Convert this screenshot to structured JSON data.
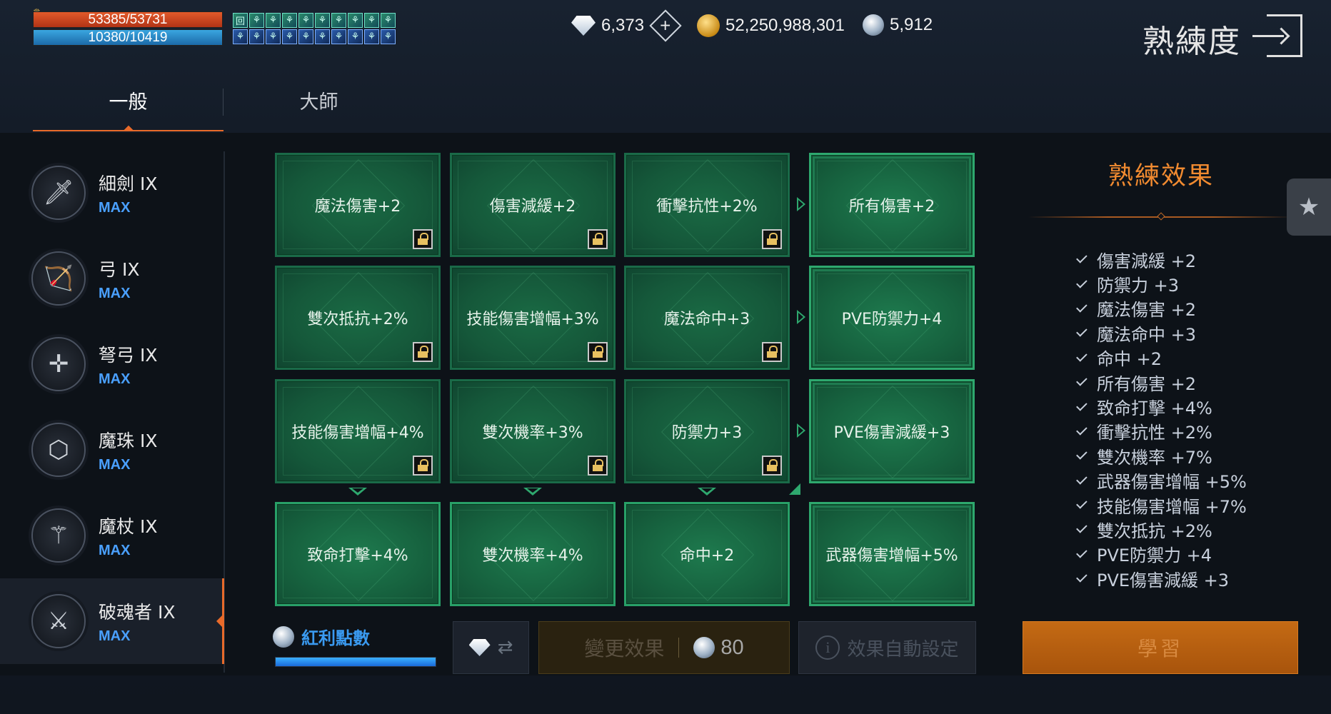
{
  "status": {
    "hp": "53385/53731",
    "mp": "10380/10419",
    "buff_row1": [
      "回",
      "⚘",
      "⚘",
      "⚘",
      "⚘",
      "⚘",
      "⚘",
      "⚘",
      "⚘",
      "⚘"
    ],
    "buff_row2": [
      "⚘",
      "⚘",
      "⚘",
      "⚘",
      "⚘",
      "⚘",
      "⚘",
      "⚘",
      "⚘",
      "⚘"
    ]
  },
  "currencies": {
    "diamond": "6,373",
    "gold": "52,250,988,301",
    "orb": "5,912"
  },
  "header": {
    "title": "熟練度"
  },
  "tabs": [
    {
      "label": "一般",
      "active": true
    },
    {
      "label": "大師",
      "active": false
    }
  ],
  "weapons": [
    {
      "name": "細劍 IX",
      "level": "MAX",
      "icon": "rapier-icon"
    },
    {
      "name": "弓 IX",
      "level": "MAX",
      "icon": "bow-icon"
    },
    {
      "name": "弩弓 IX",
      "level": "MAX",
      "icon": "crossbow-icon"
    },
    {
      "name": "魔珠 IX",
      "level": "MAX",
      "icon": "orb-icon"
    },
    {
      "name": "魔杖 IX",
      "level": "MAX",
      "icon": "wand-icon"
    },
    {
      "name": "破魂者 IX",
      "level": "MAX",
      "icon": "greatsword-icon",
      "active": true
    }
  ],
  "grid": {
    "rows": [
      {
        "cells": [
          {
            "label": "魔法傷害+2",
            "locked": true
          },
          {
            "label": "傷害減緩+2",
            "locked": true
          },
          {
            "label": "衝擊抗性+2%",
            "locked": true
          }
        ],
        "reward": "所有傷害+2"
      },
      {
        "cells": [
          {
            "label": "雙次抵抗+2%",
            "locked": true
          },
          {
            "label": "技能傷害增幅+3%",
            "locked": true
          },
          {
            "label": "魔法命中+3",
            "locked": true
          }
        ],
        "reward": "PVE防禦力+4"
      },
      {
        "cells": [
          {
            "label": "技能傷害增幅+4%",
            "locked": true
          },
          {
            "label": "雙次機率+3%",
            "locked": true
          },
          {
            "label": "防禦力+3",
            "locked": true
          }
        ],
        "reward": "PVE傷害減緩+3"
      },
      {
        "cells": [
          {
            "label": "致命打擊+4%",
            "locked": false
          },
          {
            "label": "雙次機率+4%",
            "locked": false
          },
          {
            "label": "命中+2",
            "locked": false
          }
        ],
        "reward": "武器傷害增幅+5%"
      }
    ]
  },
  "effects": {
    "title": "熟練效果",
    "items": [
      "傷害減緩 +2",
      "防禦力 +3",
      "魔法傷害 +2",
      "魔法命中 +3",
      "命中 +2",
      "所有傷害 +2",
      "致命打擊 +4%",
      "衝擊抗性 +2%",
      "雙次機率 +7%",
      "武器傷害增幅 +5%",
      "技能傷害增幅 +7%",
      "雙次抵抗 +2%",
      "PVE防禦力 +4",
      "PVE傷害減緩 +3"
    ]
  },
  "bottom": {
    "bonus_label": "紅利點數",
    "bonus_fill": 1.0,
    "change_label": "變更效果",
    "change_cost": "80",
    "auto_label": "效果自動設定",
    "learn_label": "學習"
  },
  "colors": {
    "accent": "#e86a2a",
    "effects_title": "#f08a30",
    "max_blue": "#4aa0ff",
    "cell_green": "#176440"
  }
}
